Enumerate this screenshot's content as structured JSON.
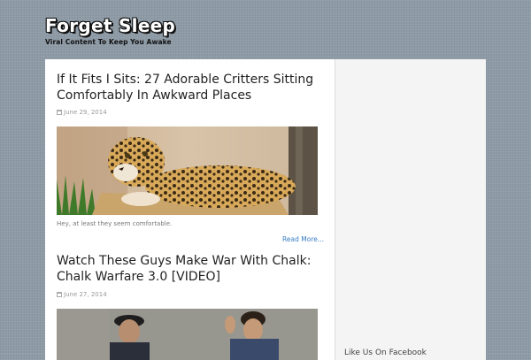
{
  "site": {
    "logo_title": "Forget Sleep",
    "logo_tagline": "Viral Content To Keep You Awake",
    "colors": {
      "background": "#8e9ba6",
      "content_bg": "#ffffff",
      "sidebar_bg": "#f4f4f4",
      "link": "#3a7cc4"
    }
  },
  "posts": [
    {
      "title": "If It Fits I Sits: 27 Adorable Critters Sitting Comfortably In Awkward Places",
      "date": "June 29, 2014",
      "date_icon": "calendar-icon",
      "image_subject": "leopard-in-box",
      "excerpt": "Hey, at least they seem comfortable.",
      "read_more": "Read More..."
    },
    {
      "title": "Watch These Guys Make War With Chalk: Chalk Warfare 3.0 [VIDEO]",
      "date": "June 27, 2014",
      "date_icon": "calendar-icon",
      "image_subject": "two-men-in-alley"
    }
  ],
  "sidebar": {
    "heading": "Like Us On Facebook"
  }
}
